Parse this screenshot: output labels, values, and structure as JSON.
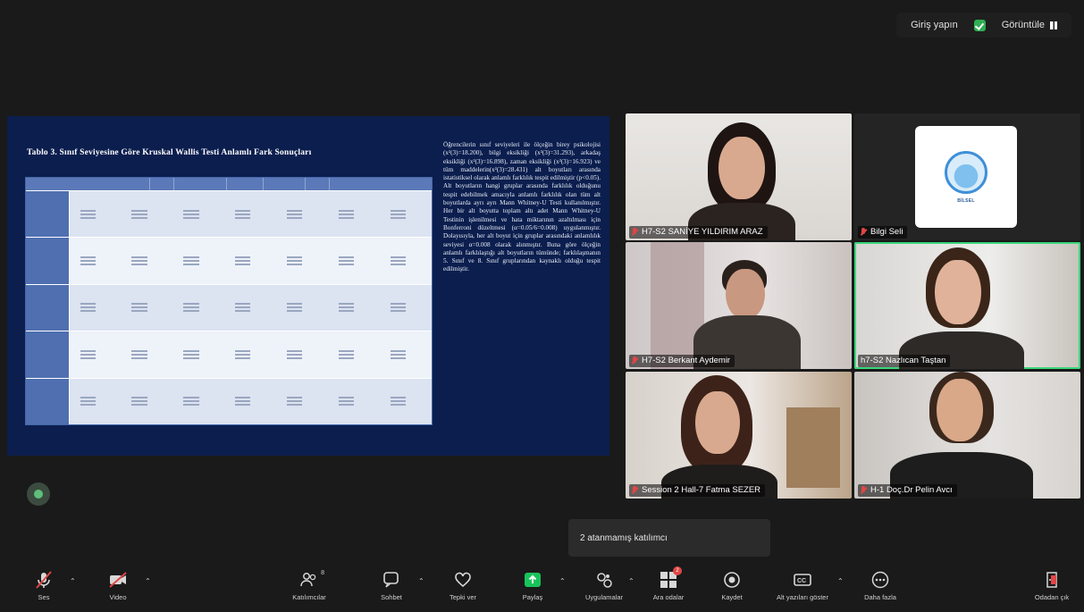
{
  "top_bar": {
    "login_label": "Giriş yapın",
    "view_label": "Görüntüle"
  },
  "slide": {
    "title": "Tablo 3. Sınıf Seviyesine Göre Kruskal Wallis Testi Anlamlı Fark Sonuçları",
    "paragraph": "Öğrencilerin sınıf seviyeleri ile ölçeğin birey psikolojisi (x²(3)=18.200), bilgi eksikliği (x²(3)=31.293), arkadaş eksikliği (x²(3)=16.898), zaman eksikliği (x²(3)=16.923) ve tüm maddelerin(x²(3)=28.431) alt boyutları arasında istatistiksel olarak anlamlı farklılık tespit edilmiştir (p<0.05). Alt boyutların hangi gruplar arasında farklılık olduğunu tespit edebilmek amacıyla anlamlı farklılık olan tüm alt boyutlarda ayrı ayrı Mann Whitney-U Testi kullanılmıştır. Her bir alt boyutta toplam altı adet Mann Whitney-U Testinin işlenilmesi ve hata miktarının azaltılması için Bonferroni düzeltmesi (α=0.05/6=0.008) uygulanmıştır. Dolayısıyla, her alt boyut için gruplar arasındaki anlamlılık seviyesi α=0.008 olarak alınmıştır. Buna göre ölçeğin anlamlı farklılaştığı alt boyutların tümünde; farklılaşmanın 5. Sınıf ve 8. Sınıf gruplarından kaynaklı olduğu tespit edilmiştir."
  },
  "participants": [
    {
      "name": "H7-S2 SANİYE YILDIRIM ARAZ",
      "muted": true
    },
    {
      "name": "Bilgi Seli",
      "muted": true
    },
    {
      "name": "H7-S2 Berkant Aydemir",
      "muted": true
    },
    {
      "name": "h7-S2 Nazlıcan Taştan",
      "muted": false
    },
    {
      "name": "Session 2 Hall-7 Fatma SEZER",
      "muted": true
    },
    {
      "name": "H-1 Doç.Dr Pelin Avcı",
      "muted": true
    }
  ],
  "bilgi_seli_logo_text": "BİLSEL",
  "tooltip": "2 atanmamış katılımcı",
  "toolbar": {
    "mute": "Ses",
    "video": "Video",
    "participants": "Katılımcılar",
    "participants_count": "8",
    "chat": "Sohbet",
    "react": "Tepki ver",
    "share": "Paylaş",
    "apps": "Uygulamalar",
    "breakout": "Ara odalar",
    "breakout_badge": "2",
    "record": "Kaydet",
    "captions": "Alt yazıları göster",
    "more": "Daha fazla",
    "leave": "Odadan çık"
  },
  "colors": {
    "active_speaker": "#3ad67b",
    "muted_red": "#e04646",
    "share_green": "#19c35b",
    "slide_bg": "#0b1e4e"
  }
}
